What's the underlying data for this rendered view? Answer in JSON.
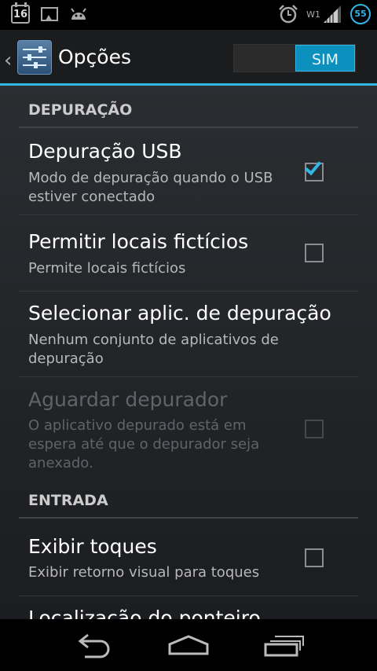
{
  "status_bar": {
    "calendar_day": "16",
    "wifi_label": "W1",
    "battery_level": "55",
    "icons": [
      "calendar-icon",
      "image-icon",
      "android-icon",
      "alarm-icon",
      "signal-icon",
      "battery-icon"
    ],
    "accent_color": "#33b5e5"
  },
  "action_bar": {
    "title": "Opções",
    "toggle_label": "SIM",
    "toggle_on": true
  },
  "sections": [
    {
      "header": "DEPURAÇÃO",
      "items": [
        {
          "title": "Depuração USB",
          "summary": "Modo de depuração quando o USB estiver conectado",
          "checked": true,
          "enabled": true
        },
        {
          "title": "Permitir locais fictícios",
          "summary": "Permite locais fictícios",
          "checked": false,
          "enabled": true
        },
        {
          "title": "Selecionar aplic. de depuração",
          "summary": "Nenhum conjunto de aplicativos de depuração",
          "enabled": true
        },
        {
          "title": "Aguardar depurador",
          "summary": "O aplicativo depurado está em espera até que o depurador seja anexado.",
          "checked": false,
          "enabled": false
        }
      ]
    },
    {
      "header": "ENTRADA",
      "items": [
        {
          "title": "Exibir toques",
          "summary": "Exibir retorno visual para toques",
          "checked": false,
          "enabled": true
        },
        {
          "title": "Localização do ponteiro",
          "enabled": true
        }
      ]
    }
  ],
  "nav_bar": {
    "icons": [
      "back-icon",
      "home-icon",
      "recent-apps-icon"
    ]
  }
}
